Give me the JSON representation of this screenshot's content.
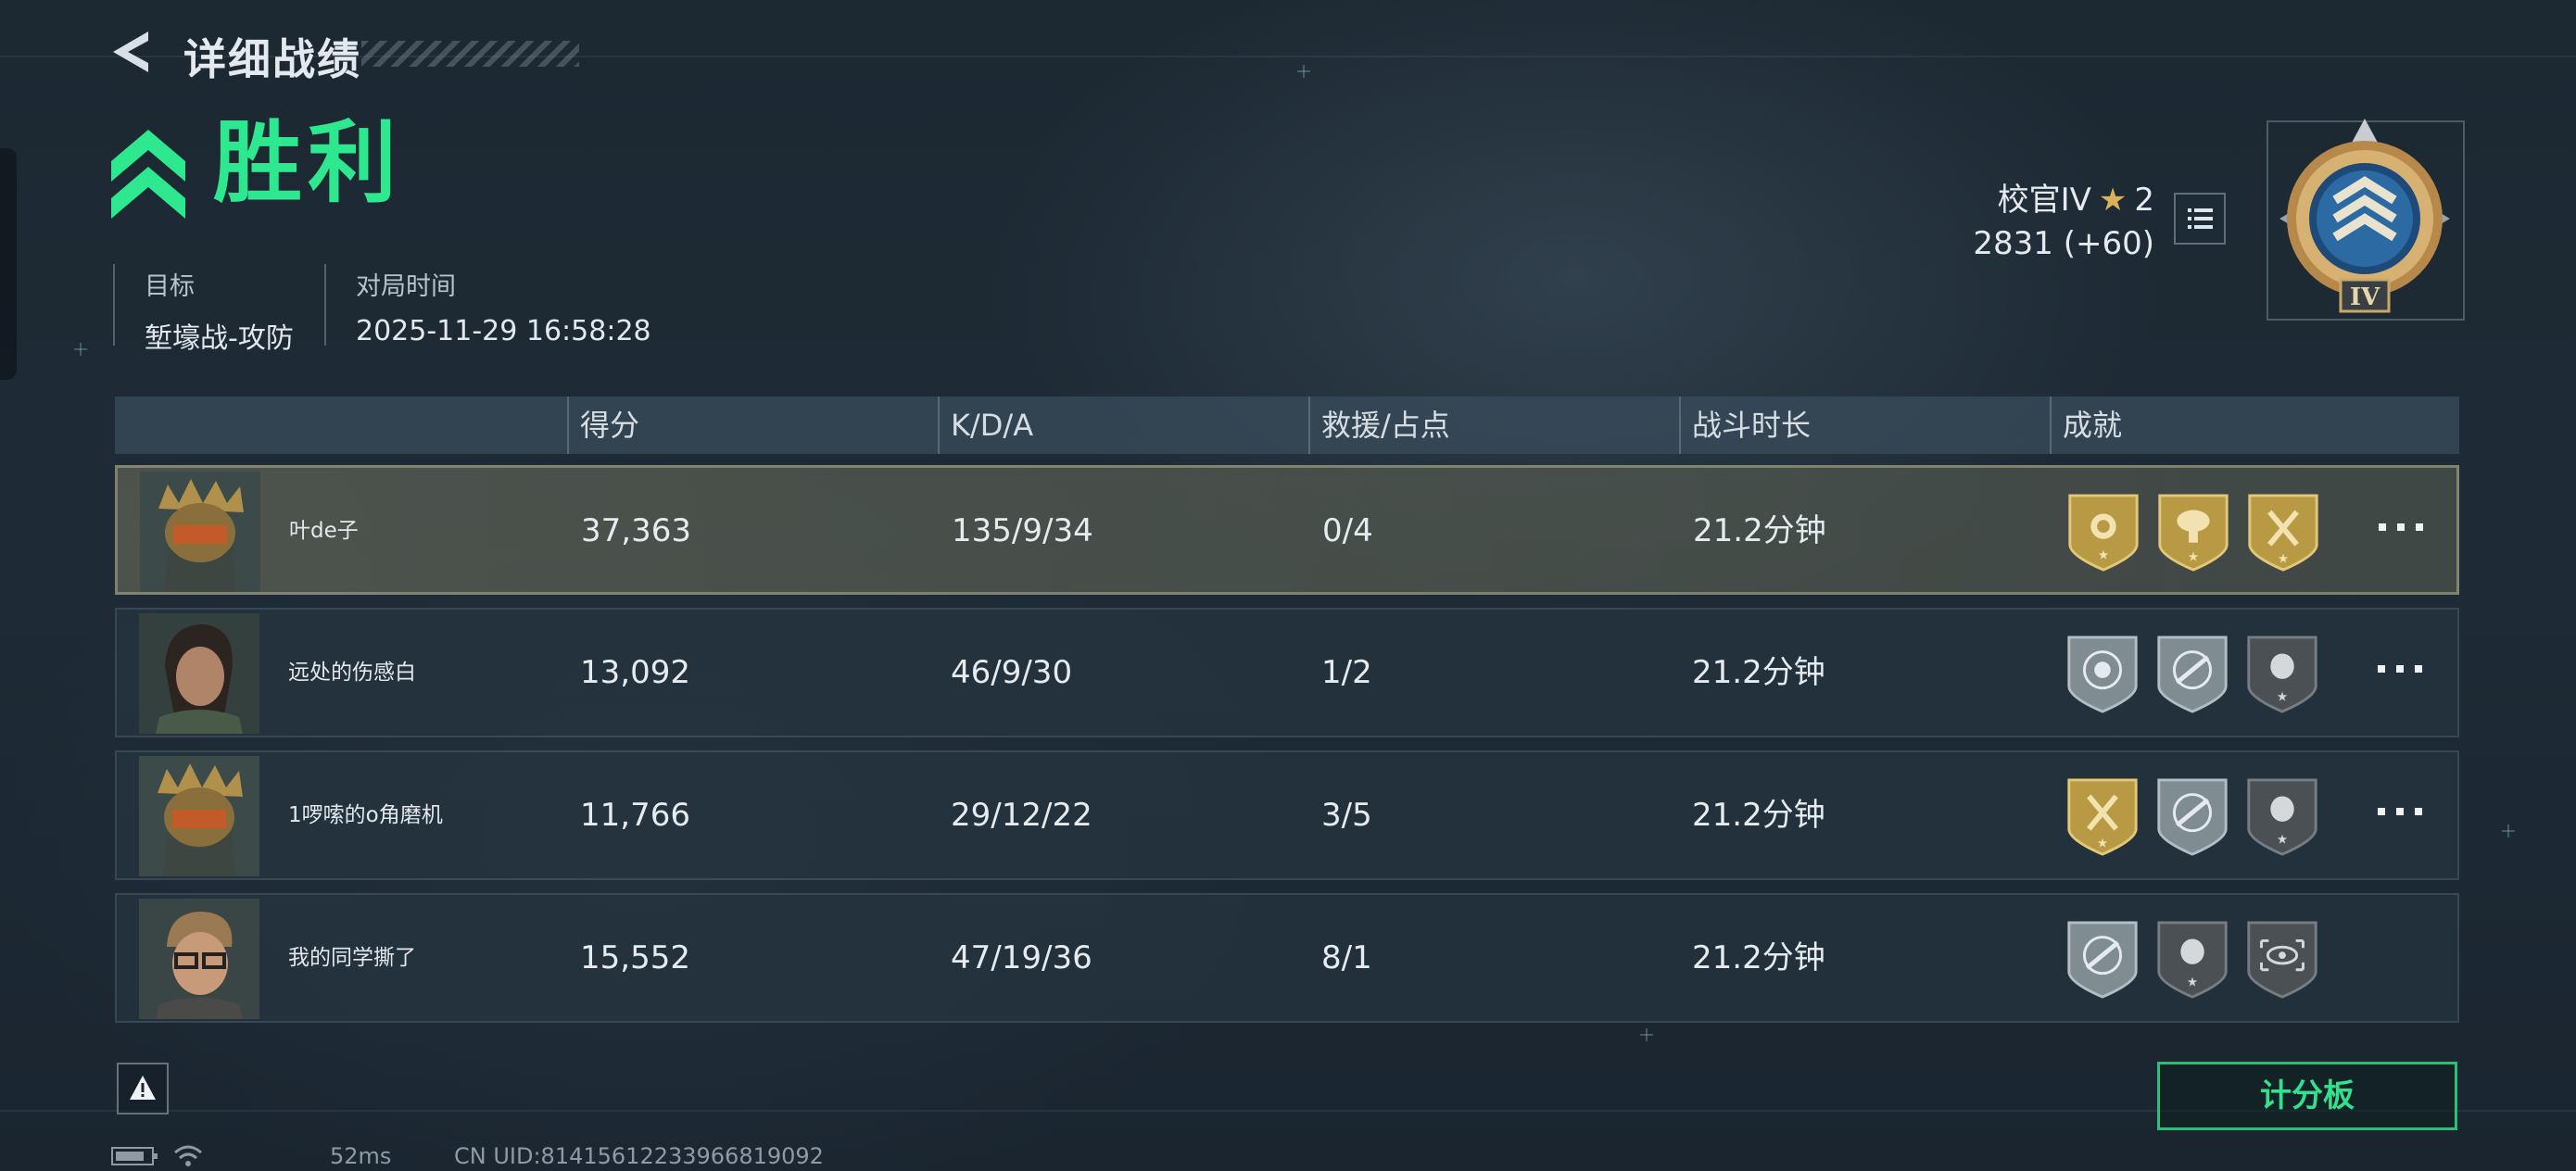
{
  "header": {
    "title": "详细战绩"
  },
  "result": {
    "label": "胜利",
    "objective_label": "目标",
    "objective_value": "堑壕战-攻防",
    "time_label": "对局时间",
    "time_value": "2025-11-29 16:58:28"
  },
  "rank": {
    "name": "校官IV",
    "stars": "2",
    "points": "2831 (+60)",
    "emblem_numeral": "IV"
  },
  "table": {
    "headers": [
      "得分",
      "K/D/A",
      "救援/占点",
      "战斗时长",
      "成就"
    ],
    "rows": [
      {
        "name": "叶de子",
        "score": "37,363",
        "kda": "135/9/34",
        "rescue": "0/4",
        "duration": "21.2分钟",
        "self": true,
        "badges": [
          "gold-rose-badge",
          "gold-explosion-badge",
          "gold-axes-badge"
        ]
      },
      {
        "name": "远处的伤感白",
        "score": "13,092",
        "kda": "46/9/30",
        "rescue": "1/2",
        "duration": "21.2分钟",
        "self": false,
        "badges": [
          "silver-skull-target-badge",
          "silver-gun-target-badge",
          "dark-skull-badge"
        ]
      },
      {
        "name": "1啰嗦的o角磨机",
        "score": "11,766",
        "kda": "29/12/22",
        "rescue": "3/5",
        "duration": "21.2分钟",
        "self": false,
        "badges": [
          "gold-axes-badge",
          "silver-gun-target-badge",
          "dark-skull-badge"
        ]
      },
      {
        "name": "我的同学撕了",
        "score": "15,552",
        "kda": "47/19/36",
        "rescue": "8/1",
        "duration": "21.2分钟",
        "self": false,
        "badges": [
          "silver-gun-target-badge",
          "dark-skull-badge",
          "dark-eye-badge"
        ]
      }
    ]
  },
  "footer": {
    "scoreboard_label": "计分板",
    "ping": "52ms",
    "uid": "CN UID:814156122339668190​92"
  },
  "colors": {
    "accent": "#2de88f",
    "gold": "#b89a45",
    "silver": "#7f8c92"
  }
}
